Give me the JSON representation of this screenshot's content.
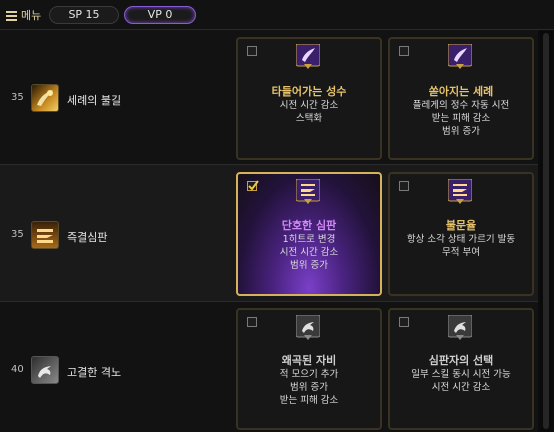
{
  "topbar": {
    "menu_label": "메뉴",
    "sp_label": "SP 15",
    "vp_label": "VP 0"
  },
  "rows": [
    {
      "level": "35",
      "skill_name": "세례의 불길",
      "icon": "flame-baptism-icon",
      "options": [
        {
          "checked": false,
          "title": "타들어가는 성수",
          "lines": [
            "시전 시간 감소",
            "스택화"
          ],
          "icon": "rune-1-icon",
          "title_color": "#e6c36a"
        },
        {
          "checked": false,
          "title": "쏟아지는 세례",
          "lines": [
            "플레게의 정수 자동 시전",
            "받는 피해 감소",
            "범위 증가"
          ],
          "icon": "rune-2-icon",
          "title_color": "#e6c36a"
        }
      ]
    },
    {
      "level": "35",
      "skill_name": "즉결심판",
      "icon": "judgement-icon",
      "options": [
        {
          "checked": true,
          "title": "단호한 심판",
          "lines": [
            "1히트로 변경",
            "시전 시간 감소",
            "범위 증가"
          ],
          "icon": "rune-1-icon",
          "title_color": "#d38af5"
        },
        {
          "checked": false,
          "title": "불문율",
          "lines": [
            "항상 소각 상태 가르기 발동",
            "무적 부여"
          ],
          "icon": "rune-2-icon",
          "title_color": "#e6c36a"
        }
      ]
    },
    {
      "level": "40",
      "skill_name": "고결한 격노",
      "icon": "noble-fury-icon",
      "options": [
        {
          "checked": false,
          "title": "왜곡된 자비",
          "lines": [
            "적 모으기 추가",
            "범위 증가",
            "받는 피해 감소"
          ],
          "icon": "rune-1-icon",
          "title_color": "#cfcfcf"
        },
        {
          "checked": false,
          "title": "심판자의 선택",
          "lines": [
            "일부 스킬 동시 시전 가능",
            "시전 시간 감소"
          ],
          "icon": "rune-2-icon",
          "title_color": "#cfcfcf"
        }
      ]
    }
  ]
}
